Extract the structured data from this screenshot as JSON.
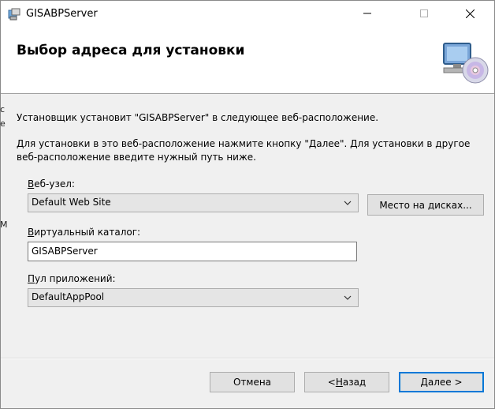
{
  "window": {
    "title": "GISABPServer",
    "controls": {
      "minimize": "—",
      "maximize": "☐",
      "close": "✕"
    }
  },
  "header": {
    "title": "Выбор адреса для установки",
    "icon": "computer-cd-icon"
  },
  "body": {
    "intro": "Установщик установит \"GISABPServer\" в следующее веб-расположение.",
    "instructions": "Для установки в это веб-расположение нажмите кнопку \"Далее\". Для установки в другое веб-расположение введите нужный путь ниже."
  },
  "fields": {
    "website": {
      "label_accel": "В",
      "label_rest": "еб-узел:",
      "value": "Default Web Site"
    },
    "disk_button": {
      "label": "Место на дисках..."
    },
    "virtual_dir": {
      "label_accel": "В",
      "label_rest": "иртуальный каталог:",
      "value": "GISABPServer"
    },
    "app_pool": {
      "label_accel": "П",
      "label_rest": "ул приложений:",
      "value": "DefaultAppPool"
    }
  },
  "footer": {
    "cancel": "Отмена",
    "back_prefix": "< ",
    "back_accel": "Н",
    "back_rest": "азад",
    "next_accel": "Д",
    "next_rest": "алее >"
  },
  "background_glyphs": [
    "с",
    "е",
    "М"
  ],
  "colors": {
    "accent": "#0078d7",
    "button_bg": "#e1e1e1",
    "dialog_bg": "#f0f0f0"
  }
}
